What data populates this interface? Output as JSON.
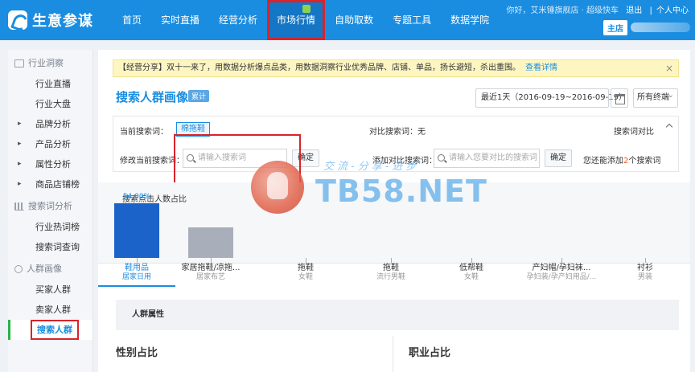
{
  "app": {
    "logo_text": "生意参谋",
    "nav": [
      {
        "label": "首页"
      },
      {
        "label": "实时直播"
      },
      {
        "label": "经营分析"
      },
      {
        "label": "市场行情"
      },
      {
        "label": "自助取数"
      },
      {
        "label": "专题工具"
      },
      {
        "label": "数据学院"
      }
    ],
    "user_greeting": "你好，艾米锤旗舰店 · 超级快车",
    "logout": "退出",
    "personal_center": "个人中心",
    "separator": "|",
    "store_badge": "主店"
  },
  "sidebar": {
    "groups": [
      {
        "title": "行业洞察",
        "items": [
          "行业直播",
          "行业大盘",
          "品牌分析",
          "产品分析",
          "属性分析",
          "商品店铺榜"
        ]
      },
      {
        "title": "搜索词分析",
        "items": [
          "行业热词榜",
          "搜索词查询"
        ]
      },
      {
        "title": "人群画像",
        "items": [
          "买家人群",
          "卖家人群",
          "搜索人群"
        ]
      }
    ]
  },
  "notice": {
    "text": "【经营分享】双十一来了，用数据分析爆点品类，用数据洞察行业优秀品牌、店铺、单品，扬长避短，杀出重围。",
    "link": "查看详情",
    "close": "×"
  },
  "page": {
    "title": "搜索人群画像",
    "tag": "累计",
    "date_range": "最近1天（2016-09-19~2016-09-19）",
    "device": "所有终端"
  },
  "filter": {
    "current_label": "当前搜索词：",
    "current_keyword": "棉拖鞋",
    "compare_label": "对比搜索词：无",
    "compare_toggle": "搜索词对比",
    "modify_label": "修改当前搜索词：",
    "modify_placeholder": "请输入搜索词",
    "confirm": "确定",
    "add_label": "添加对比搜索词：",
    "add_placeholder": "请输入您要对比的搜索词",
    "confirm2": "确定",
    "remaining_prefix": "您还能添加",
    "remaining_count": "2",
    "remaining_suffix": "个搜索词"
  },
  "chart_data": {
    "type": "bar",
    "title": "搜索点击人数占比",
    "ylim": [
      0,
      60
    ],
    "categories": [
      {
        "name": "鞋用品",
        "sub": "居家日用"
      },
      {
        "name": "家居拖鞋/凉拖...",
        "sub": "居家布艺"
      },
      {
        "name": "拖鞋",
        "sub": "女鞋"
      },
      {
        "name": "拖鞋",
        "sub": "流行男鞋"
      },
      {
        "name": "低帮鞋",
        "sub": "女鞋"
      },
      {
        "name": "产妇帽/孕妇袜...",
        "sub": "孕妇装/孕产妇用品/..."
      },
      {
        "name": "衬衫",
        "sub": "男装"
      }
    ],
    "values": [
      54.0,
      30,
      0,
      0,
      0,
      0,
      0
    ],
    "data_labels": [
      "54.00%"
    ],
    "colors": [
      "#1b62c9",
      "#a9afba"
    ]
  },
  "sections": {
    "crowd_attr": "人群属性",
    "gender": "性别占比",
    "occupation": "职业占比"
  },
  "watermark": {
    "text": "TB58.NET",
    "sub": "交流-分享-进步"
  }
}
